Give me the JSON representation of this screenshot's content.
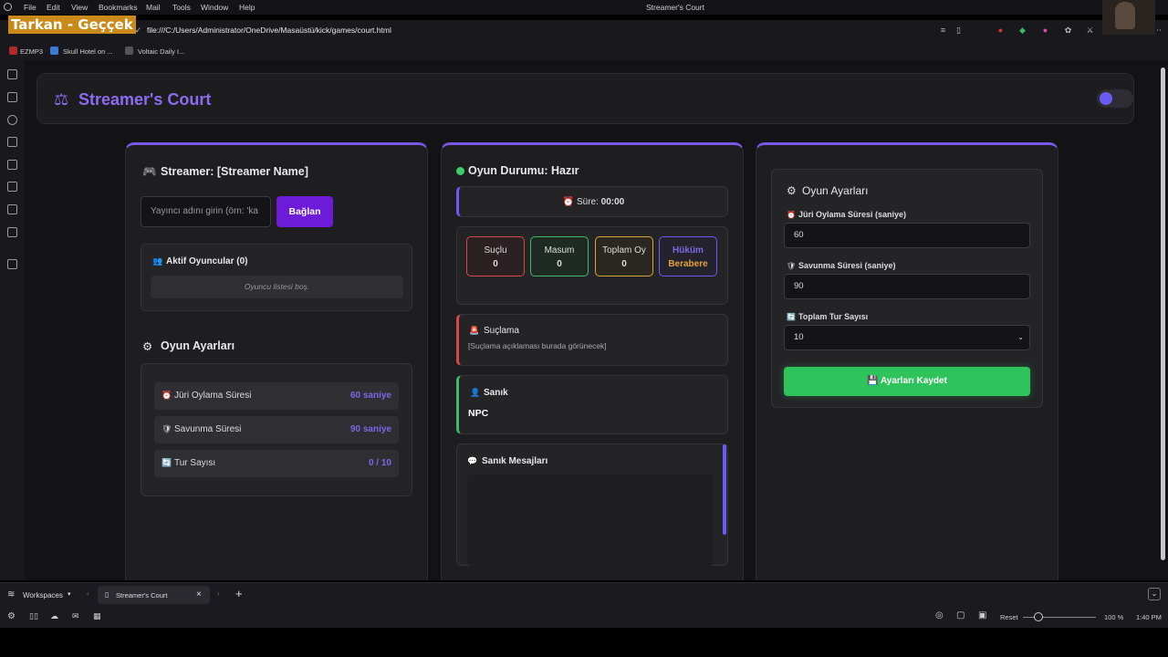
{
  "browser": {
    "menu": [
      "File",
      "Edit",
      "View",
      "Bookmarks",
      "Mail",
      "Tools",
      "Window",
      "Help"
    ],
    "window_title": "Streamer's Court",
    "url": "file:///C:/Users/Administrator/OneDrive/Masaüstü/kick/games/court.html",
    "bookmarks": [
      "EZMP3",
      "Skull Hotel on ...",
      "Voltaic Daily I..."
    ],
    "overlay_text": "Tarkan - Geççek",
    "workspaces": "Workspaces",
    "tab_title": "Streamer's Court",
    "status": {
      "reset": "Reset",
      "zoom": "100 %",
      "time": "1:40 PM"
    }
  },
  "app": {
    "title": "Streamer's Court",
    "toggle_on": true
  },
  "left": {
    "streamer_title": "Streamer: [Streamer Name]",
    "streamer_input_placeholder": "Yayıncı adını girin (örn: 'ka",
    "connect_button": "Bağlan",
    "players_title": "Aktif Oyuncular (0)",
    "players_empty": "Oyuncu listesi boş.",
    "settings_title": "Oyun Ayarları",
    "settings": [
      {
        "label": "Jüri Oylama Süresi",
        "value": "60 saniye",
        "icon": "⏰"
      },
      {
        "label": "Savunma Süresi",
        "value": "90 saniye",
        "icon": "🛡"
      },
      {
        "label": "Tur Sayısı",
        "value": "0 / 10",
        "icon": "🔄"
      }
    ]
  },
  "middle": {
    "status_title": "Oyun Durumu: Hazır",
    "timer_label": "Süre:",
    "timer_value": "00:00",
    "stats": [
      {
        "label": "Suçlu",
        "value": "0",
        "color": "#d44a4a"
      },
      {
        "label": "Masum",
        "value": "0",
        "color": "#3fb86a"
      },
      {
        "label": "Toplam Oy",
        "value": "0",
        "color": "#d9a23a"
      },
      {
        "label": "Hüküm",
        "value": "Berabere",
        "color": "#6a5bf5"
      }
    ],
    "accusation_title": "Suçlama",
    "accusation_text": "[Suçlama açıklaması burada görünecek]",
    "defendant_title": "Sanık",
    "defendant_name": "NPC",
    "messages_title": "Sanık Mesajları"
  },
  "right": {
    "settings_title": "Oyun Ayarları",
    "jury_label": "Jüri Oylama Süresi (saniye)",
    "jury_value": "60",
    "defense_label": "Savunma Süresi (saniye)",
    "defense_value": "90",
    "rounds_label": "Toplam Tur Sayısı",
    "rounds_value": "10",
    "save_button": "Ayarları Kaydet"
  }
}
